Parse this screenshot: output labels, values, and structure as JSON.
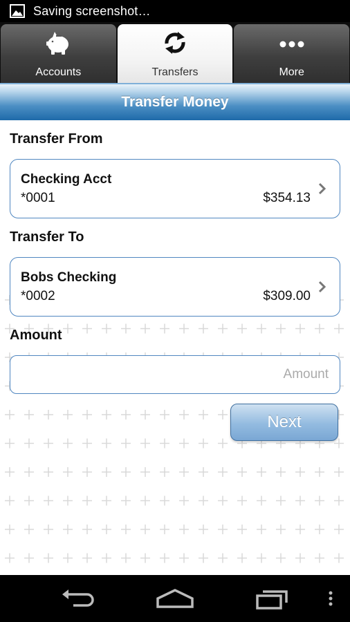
{
  "status_bar": {
    "text": "Saving screenshot…",
    "icon": "picture-icon"
  },
  "tabs": [
    {
      "label": "Accounts",
      "icon": "piggy-bank-icon",
      "active": false
    },
    {
      "label": "Transfers",
      "icon": "transfer-arrows-icon",
      "active": true
    },
    {
      "label": "More",
      "icon": "more-dots-icon",
      "active": false
    }
  ],
  "page": {
    "title": "Transfer Money"
  },
  "transfer_from": {
    "label": "Transfer From",
    "account_name": "Checking Acct",
    "account_number": "*0001",
    "balance": "$354.13"
  },
  "transfer_to": {
    "label": "Transfer To",
    "account_name": "Bobs Checking",
    "account_number": "*0002",
    "balance": "$309.00"
  },
  "amount": {
    "label": "Amount",
    "placeholder": "Amount",
    "value": ""
  },
  "next_button": {
    "label": "Next"
  },
  "nav_bar": {
    "icons": [
      "back-icon",
      "home-icon",
      "recent-apps-icon",
      "menu-icon"
    ]
  },
  "colors": {
    "accent": "#1e6aa9",
    "card_border": "#4f86c0",
    "button": "#93bbe0"
  }
}
